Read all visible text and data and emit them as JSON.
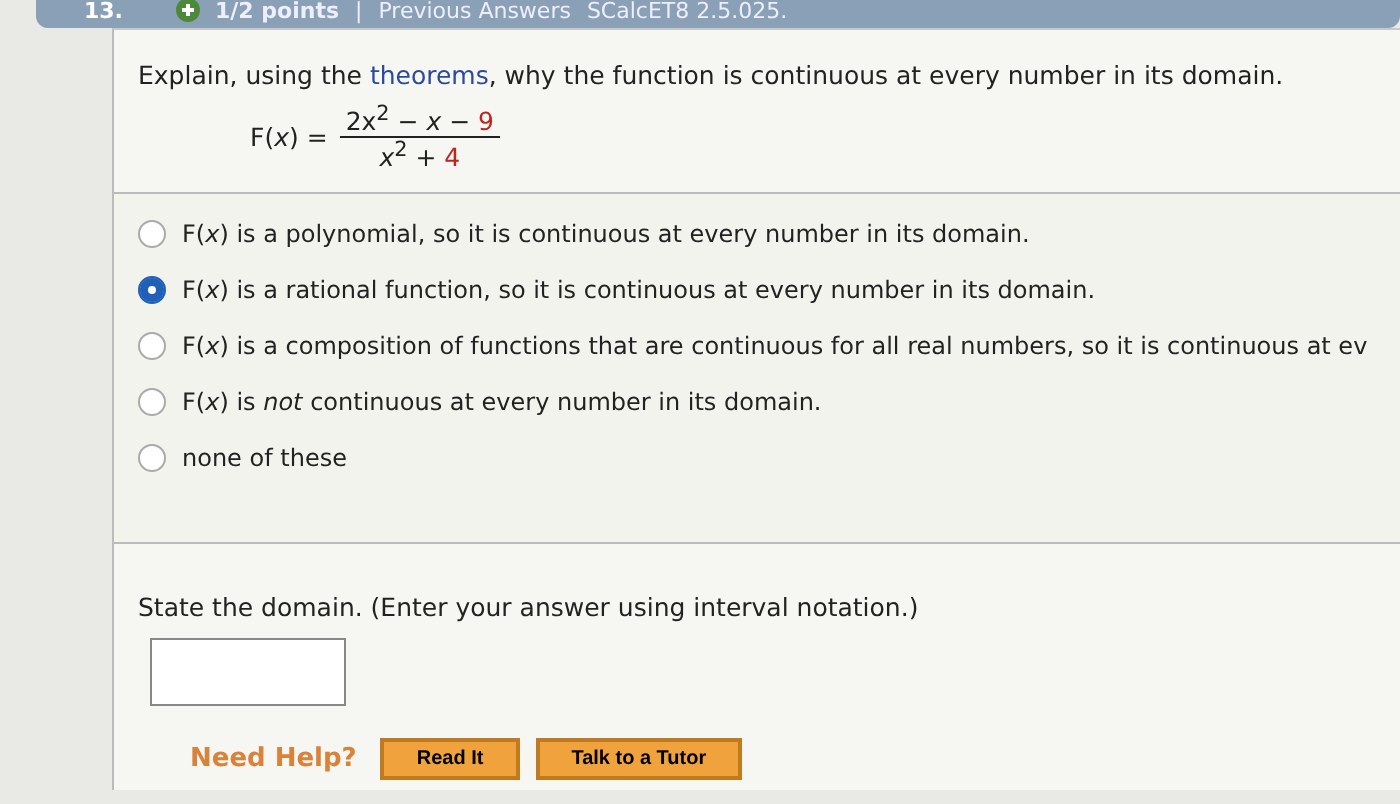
{
  "header": {
    "number": "13.",
    "points": "1/2 points",
    "separator": "|",
    "previous": "Previous Answers",
    "code": "SCalcET8 2.5.025."
  },
  "question": {
    "prompt_start": "Explain, using the ",
    "prompt_link": "theorems",
    "prompt_end": ", why the function is continuous at every number in its domain.",
    "function_name": "F(*x*) =",
    "numerator": "2x$^{2}$ − *x* − ",
    "numerator_constant": "9",
    "denominator": "*x*$^{2}$ + ",
    "denominator_constant": "4"
  },
  "options": [
    {
      "text": "F(*x*) is a polynomial, so it is continuous at every number in its domain.",
      "selected": false
    },
    {
      "text": "F(*x*) is a rational function, so it is continuous at every number in its domain.",
      "selected": true
    },
    {
      "text": "F(*x*) is a composition of functions that are continuous for all real numbers, so it is continuous at ev",
      "selected": false
    },
    {
      "text": "F(*x*) is *not* continuous at every number in its domain.",
      "selected": false
    },
    {
      "text": "none of these",
      "selected": false
    }
  ],
  "domain": {
    "prompt": "State the domain. (Enter your answer using interval notation.)"
  },
  "help": {
    "label": "Need Help?",
    "buttons": [
      "Read It",
      "Talk to a Tutor"
    ]
  }
}
